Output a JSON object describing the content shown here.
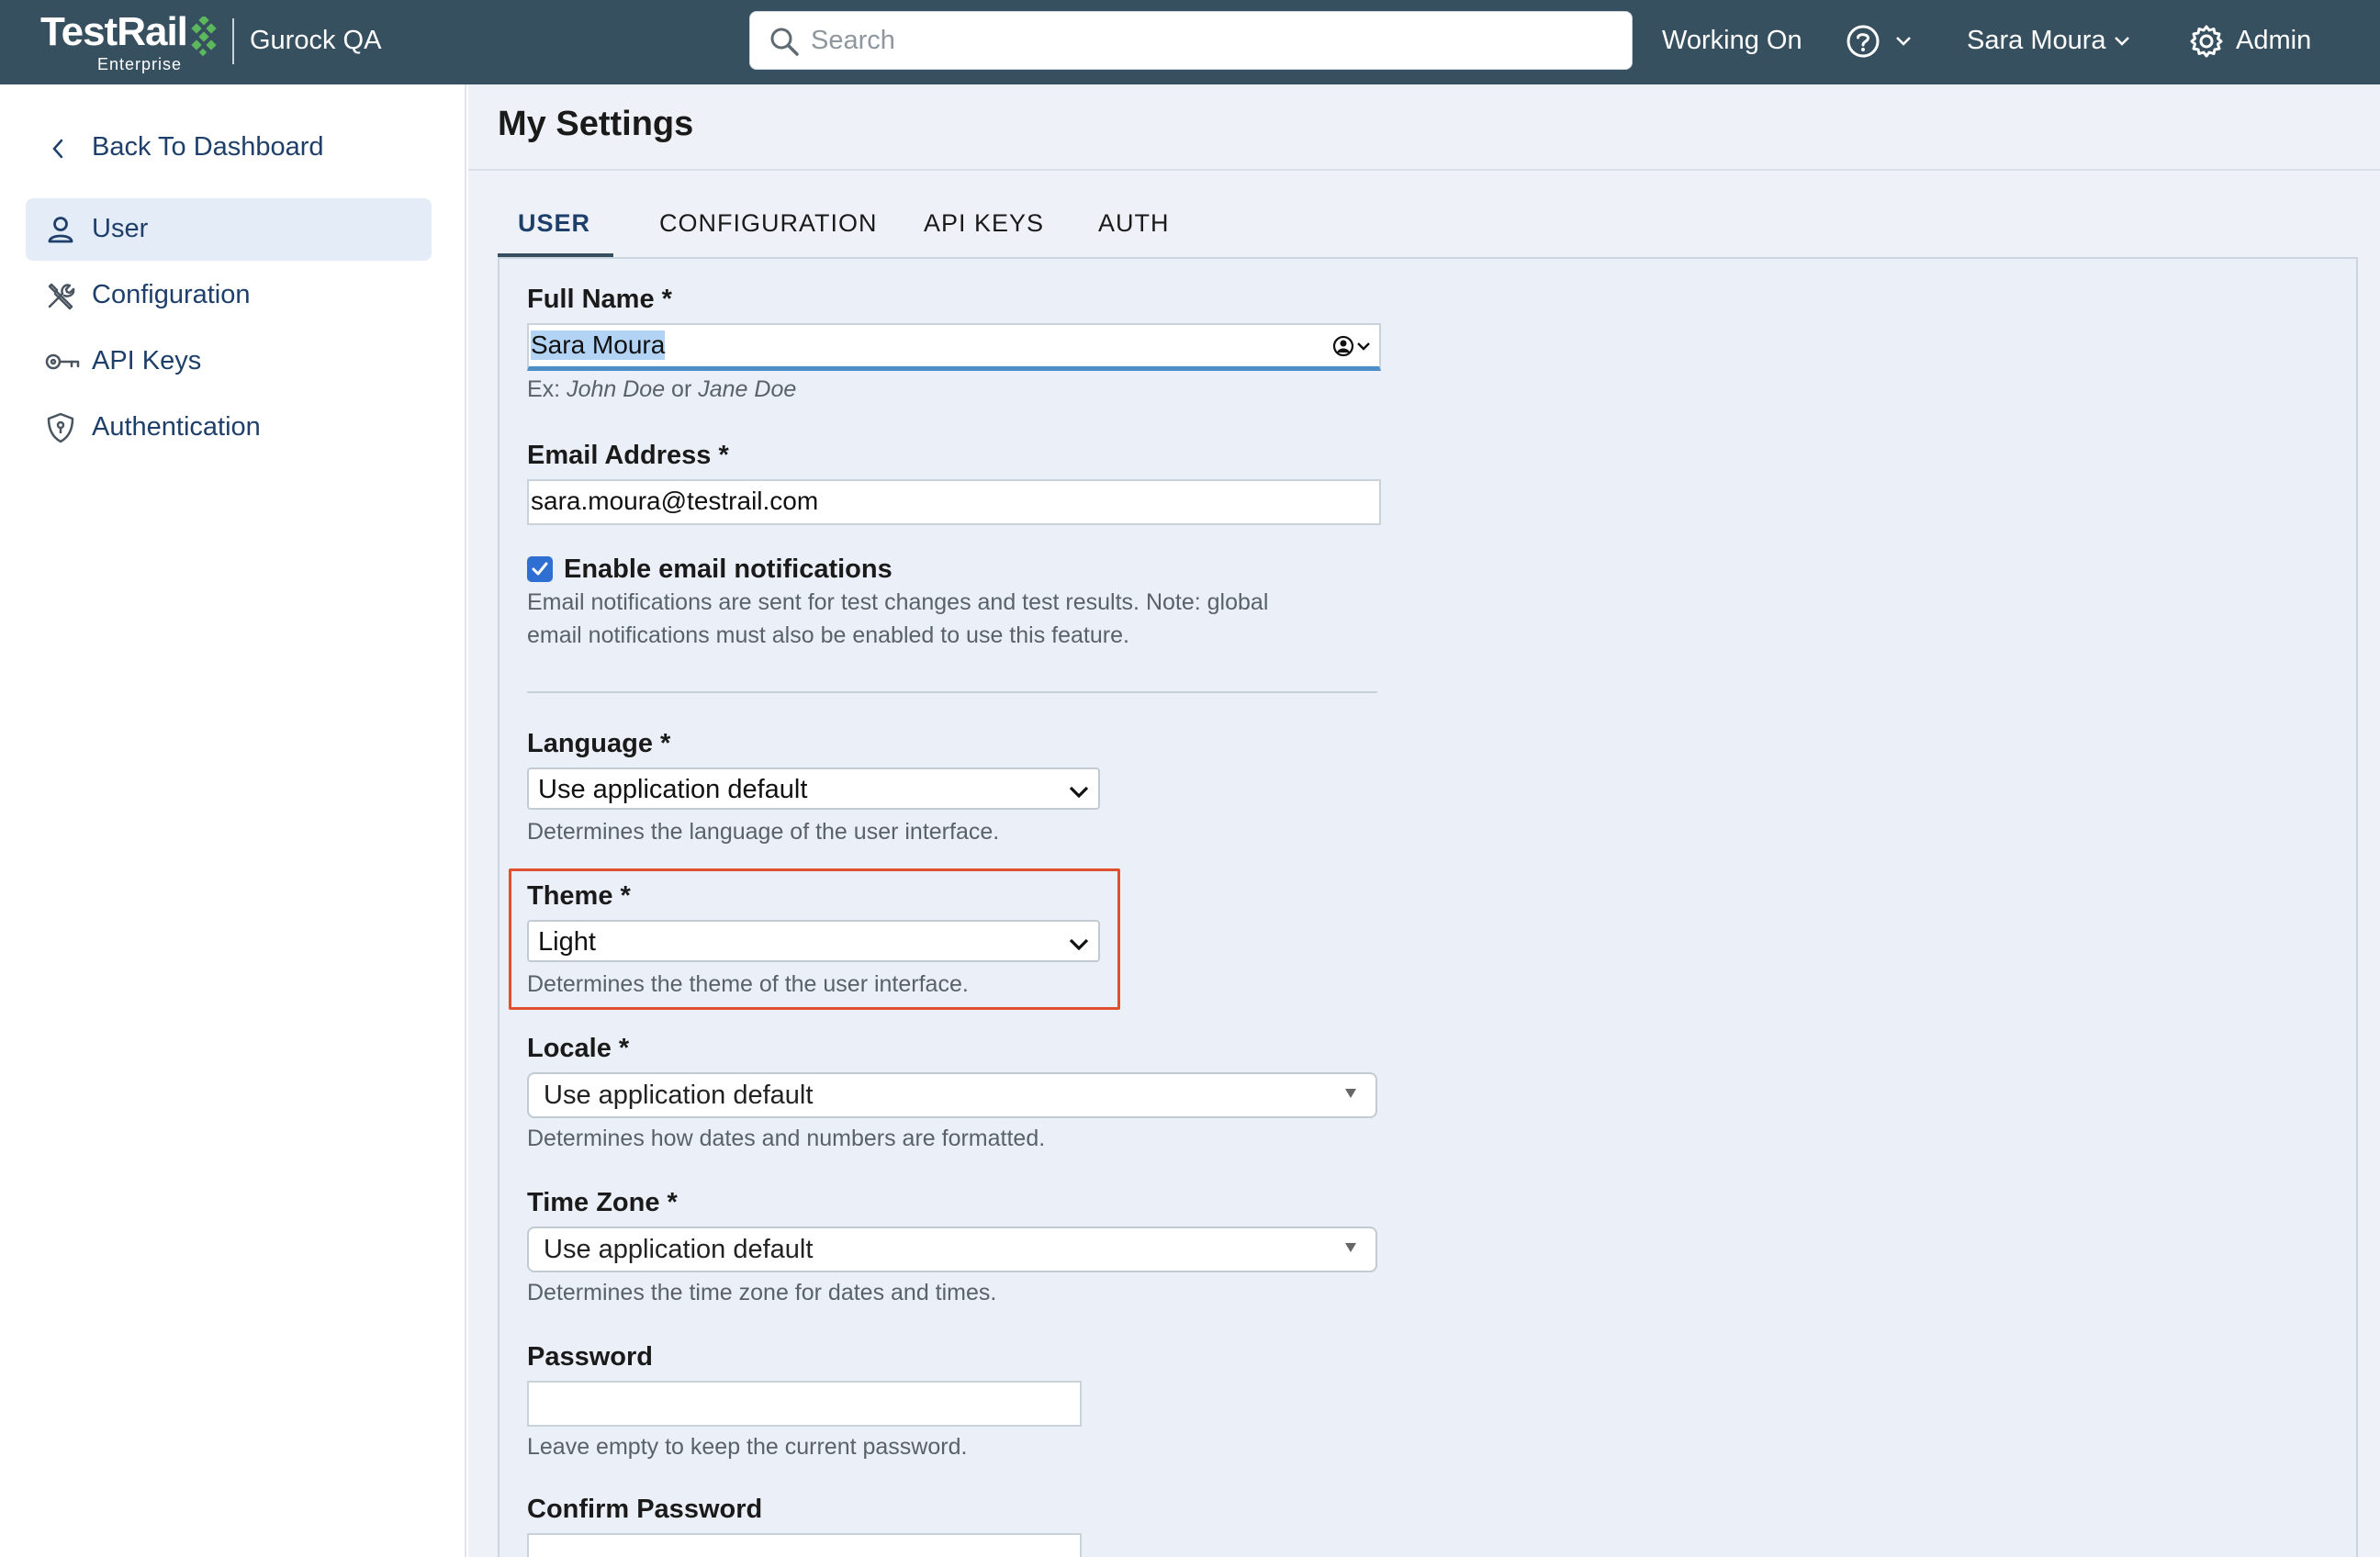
{
  "header": {
    "logo_text": "TestRail",
    "logo_subtitle": "Enterprise",
    "project_name": "Gurock QA",
    "search_placeholder": "Search",
    "working_on": "Working On",
    "user_name": "Sara Moura",
    "admin_label": "Admin",
    "icons": [
      "search-icon",
      "help-icon",
      "chevron-down-icon",
      "gear-icon"
    ]
  },
  "sidebar": {
    "back_label": "Back To Dashboard",
    "items": [
      {
        "label": "User",
        "icon": "user-icon",
        "active": true
      },
      {
        "label": "Configuration",
        "icon": "tools-icon",
        "active": false
      },
      {
        "label": "API Keys",
        "icon": "key-icon",
        "active": false
      },
      {
        "label": "Authentication",
        "icon": "shield-icon",
        "active": false
      }
    ]
  },
  "main": {
    "title": "My Settings",
    "tabs": [
      {
        "label": "USER",
        "active": true
      },
      {
        "label": "CONFIGURATION",
        "active": false
      },
      {
        "label": "API KEYS",
        "active": false
      },
      {
        "label": "AUTH",
        "active": false
      }
    ]
  },
  "form": {
    "full_name": {
      "label": "Full Name *",
      "value": "Sara Moura",
      "help_prefix": "Ex: ",
      "help_example_1": "John Doe",
      "help_or": " or ",
      "help_example_2": "Jane Doe"
    },
    "email": {
      "label": "Email Address *",
      "value": "sara.moura@testrail.com"
    },
    "notifications": {
      "label": "Enable email notifications",
      "checked": true,
      "help_line_1": "Email notifications are sent for test changes and test results. Note: global",
      "help_line_2": "email notifications must also be enabled to use this feature."
    },
    "language": {
      "label": "Language *",
      "value": "Use application default",
      "help": "Determines the language of the user interface."
    },
    "theme": {
      "label": "Theme *",
      "value": "Light",
      "help": "Determines the theme of the user interface."
    },
    "locale": {
      "label": "Locale *",
      "value": "Use application default",
      "help": "Determines how dates and numbers are formatted."
    },
    "time_zone": {
      "label": "Time Zone *",
      "value": "Use application default",
      "help": "Determines the time zone for dates and times."
    },
    "password": {
      "label": "Password",
      "value": "",
      "help": "Leave empty to keep the current password."
    },
    "confirm_password": {
      "label": "Confirm Password",
      "value": ""
    }
  },
  "colors": {
    "topbar": "#37505f",
    "accent": "#2e6fd1",
    "highlight": "#e0502e",
    "logo_green": "#5cb85c"
  }
}
